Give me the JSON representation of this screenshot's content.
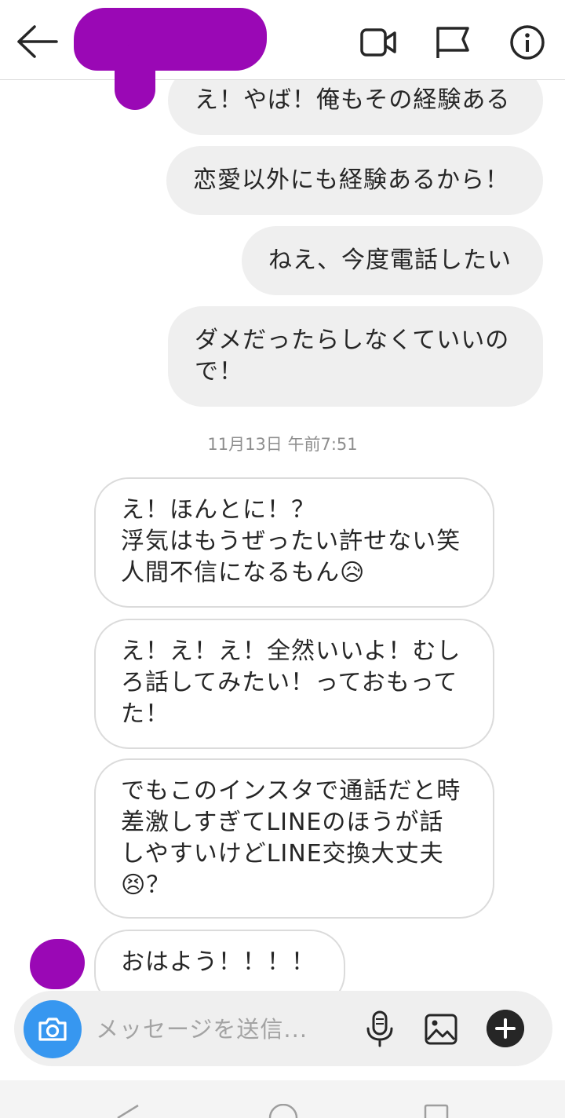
{
  "header": {
    "back_icon": "arrow-left-icon",
    "actions": [
      "video-call-icon",
      "flag-icon",
      "info-icon"
    ]
  },
  "messages": [
    {
      "from": "me",
      "text": "え！やば！俺もその経験ある"
    },
    {
      "from": "me",
      "text": "恋愛以外にも経験あるから！"
    },
    {
      "from": "me",
      "text": "ねえ、今度電話したい"
    },
    {
      "from": "me",
      "text": "ダメだったらしなくていいの\nで！"
    },
    {
      "from": "them",
      "text": "え！ほんとに！？\n浮気はもうぜったい許せない笑\n人間不信になるもん😥"
    },
    {
      "from": "them",
      "text": "え！え！え！全然いいよ！むし\nろ話してみたい！っておもって\nた！"
    },
    {
      "from": "them",
      "text": "でもこのインスタで通話だと時\n差激しすぎてLINEのほうが話\nしやすいけどLINE交換大丈夫\n😣？"
    },
    {
      "from": "them",
      "text": "おはよう！！！！"
    }
  ],
  "timestamp": "11月13日 午前7:51",
  "composer": {
    "placeholder": "メッセージを送信...",
    "icons": [
      "camera-icon",
      "microphone-icon",
      "gallery-icon",
      "plus-icon"
    ]
  },
  "colors": {
    "accent": "#3797f0",
    "redaction": "#9a08b5",
    "outgoing_bubble": "#efefef",
    "incoming_border": "#dbdbdb",
    "timestamp": "#8e8e8e"
  }
}
